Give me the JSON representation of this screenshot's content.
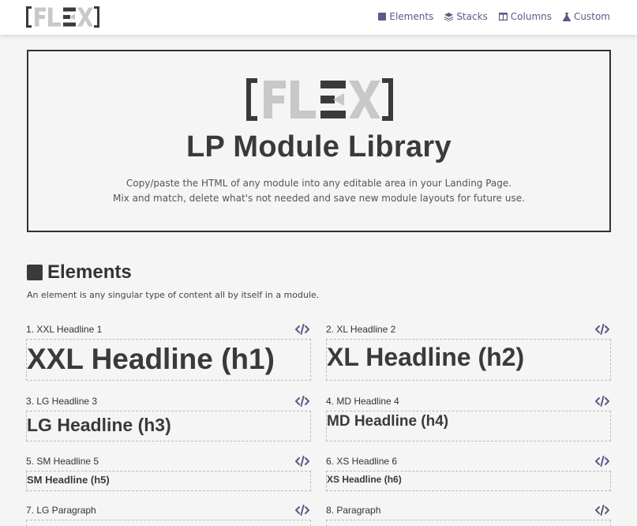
{
  "nav": {
    "items": [
      {
        "label": "Elements",
        "icon": "square-icon"
      },
      {
        "label": "Stacks",
        "icon": "layers-icon"
      },
      {
        "label": "Columns",
        "icon": "columns-icon"
      },
      {
        "label": "Custom",
        "icon": "flask-icon"
      }
    ]
  },
  "hero": {
    "title": "LP Module Library",
    "sub1": "Copy/paste the HTML of any module into any editable area in your Landing Page.",
    "sub2": "Mix and match, delete what's not needed and save new module layouts for future use."
  },
  "elements": {
    "title": "Elements",
    "description": "An element is any singular type of content all by itself in a module."
  },
  "modules": [
    {
      "label": "1. XXL Headline 1",
      "content": "XXL Headline (h1)"
    },
    {
      "label": "2. XL Headline 2",
      "content": "XL Headline (h2)"
    },
    {
      "label": "3. LG Headline 3",
      "content": "LG Headline (h3)"
    },
    {
      "label": "4. MD Headline 4",
      "content": "MD Headline (h4)"
    },
    {
      "label": "5. SM Headline 5",
      "content": "SM Headline (h5)"
    },
    {
      "label": "6. XS Headline 6",
      "content": "XS Headline (h6)"
    },
    {
      "label": "7. LG Paragraph",
      "content": ""
    },
    {
      "label": "8. Paragraph",
      "content": ""
    }
  ],
  "colors": {
    "accent": "#5c5a87",
    "logo_dark": "#3a3a3a",
    "logo_light": "#c8c8c8"
  }
}
